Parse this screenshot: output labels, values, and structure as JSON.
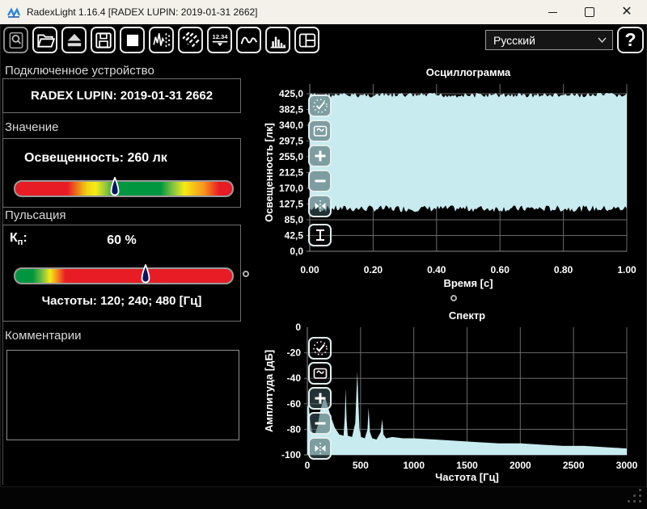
{
  "window": {
    "title": "RadexLight 1.16.4 [RADEX LUPIN: 2019-01-31 2662]"
  },
  "toolbar": {
    "icons": [
      "search-device",
      "open-file",
      "eject-device",
      "save-file",
      "stop-measurement",
      "signal-markers",
      "rays-mode",
      "numeric-display",
      "oscillogram-view",
      "spectrum-view",
      "panel-layout"
    ],
    "numeric_icon_text": "12.34",
    "language": {
      "value": "Русский"
    },
    "help_label": "?"
  },
  "sidebar": {
    "device": {
      "header": "Подключенное устройство",
      "name": "RADEX LUPIN: 2019-01-31 2662"
    },
    "value": {
      "header": "Значение",
      "reading": "Освещенность: 260 лк",
      "marker_percent": 46
    },
    "pulsation": {
      "header": "Пульсация",
      "kp_base": "К",
      "kp_sub": "п",
      "kp_colon": ":",
      "value": "60 %",
      "frequencies": "Частоты: 120; 240; 480 [Гц]",
      "marker_percent": 60
    },
    "comments": {
      "header": "Комментарии",
      "text": ""
    }
  },
  "chart_data": [
    {
      "type": "line",
      "title": "Осциллограмма",
      "xlabel": "Время [с]",
      "ylabel": "Освещенность [лк]",
      "xlim": [
        0,
        1
      ],
      "ylim": [
        0,
        425
      ],
      "xticks": [
        "0.00",
        "0.20",
        "0.40",
        "0.60",
        "0.80",
        "1.00"
      ],
      "yticks": [
        "425,0",
        "382,5",
        "340,0",
        "297,5",
        "255,0",
        "212,5",
        "170,0",
        "127,5",
        "85,0",
        "42,5",
        "0,0"
      ],
      "series": [
        {
          "name": "illuminance-waveform",
          "envelope_max": 430,
          "envelope_min": 110,
          "mean_lux": 260,
          "note": "dense flicker oscillation filling the band between envelope_min and envelope_max"
        }
      ],
      "fill_color": "#c7ebef",
      "grid": true,
      "toolbar": [
        "autoscale",
        "fit-frame",
        "zoom-in",
        "zoom-out",
        "fit-horizontal",
        "cursor"
      ]
    },
    {
      "type": "area",
      "title": "Спектр",
      "xlabel": "Частота [Гц]",
      "ylabel": "Амплитуда [дБ]",
      "xlim": [
        0,
        3000
      ],
      "ylim": [
        -100,
        0
      ],
      "xticks": [
        0,
        500,
        1000,
        1500,
        2000,
        2500,
        3000
      ],
      "yticks": [
        0,
        -20,
        -40,
        -60,
        -80,
        -100
      ],
      "points": [
        [
          0,
          -63
        ],
        [
          12,
          -60
        ],
        [
          25,
          -72
        ],
        [
          45,
          -82
        ],
        [
          70,
          -84
        ],
        [
          95,
          -78
        ],
        [
          120,
          -66
        ],
        [
          150,
          -57
        ],
        [
          165,
          -55
        ],
        [
          185,
          -60
        ],
        [
          220,
          -70
        ],
        [
          260,
          -79
        ],
        [
          300,
          -84
        ],
        [
          340,
          -85
        ],
        [
          352,
          -70
        ],
        [
          360,
          -48
        ],
        [
          368,
          -72
        ],
        [
          380,
          -85
        ],
        [
          420,
          -86
        ],
        [
          450,
          -75
        ],
        [
          462,
          -50
        ],
        [
          470,
          -35
        ],
        [
          478,
          -55
        ],
        [
          490,
          -80
        ],
        [
          505,
          -86
        ],
        [
          540,
          -87
        ],
        [
          565,
          -80
        ],
        [
          576,
          -63
        ],
        [
          588,
          -82
        ],
        [
          610,
          -87
        ],
        [
          650,
          -88
        ],
        [
          690,
          -82
        ],
        [
          703,
          -72
        ],
        [
          715,
          -84
        ],
        [
          740,
          -87
        ],
        [
          800,
          -86
        ],
        [
          900,
          -87
        ],
        [
          1000,
          -87
        ],
        [
          1200,
          -88
        ],
        [
          1400,
          -89
        ],
        [
          1600,
          -90
        ],
        [
          1800,
          -91
        ],
        [
          2000,
          -91
        ],
        [
          2200,
          -92
        ],
        [
          2400,
          -93
        ],
        [
          2600,
          -93
        ],
        [
          2800,
          -94
        ],
        [
          3000,
          -95
        ]
      ],
      "fill_color": "#c7ebef",
      "grid": true,
      "toolbar": [
        "autoscale",
        "fit-frame",
        "zoom-in",
        "zoom-out",
        "fit-horizontal"
      ]
    }
  ]
}
